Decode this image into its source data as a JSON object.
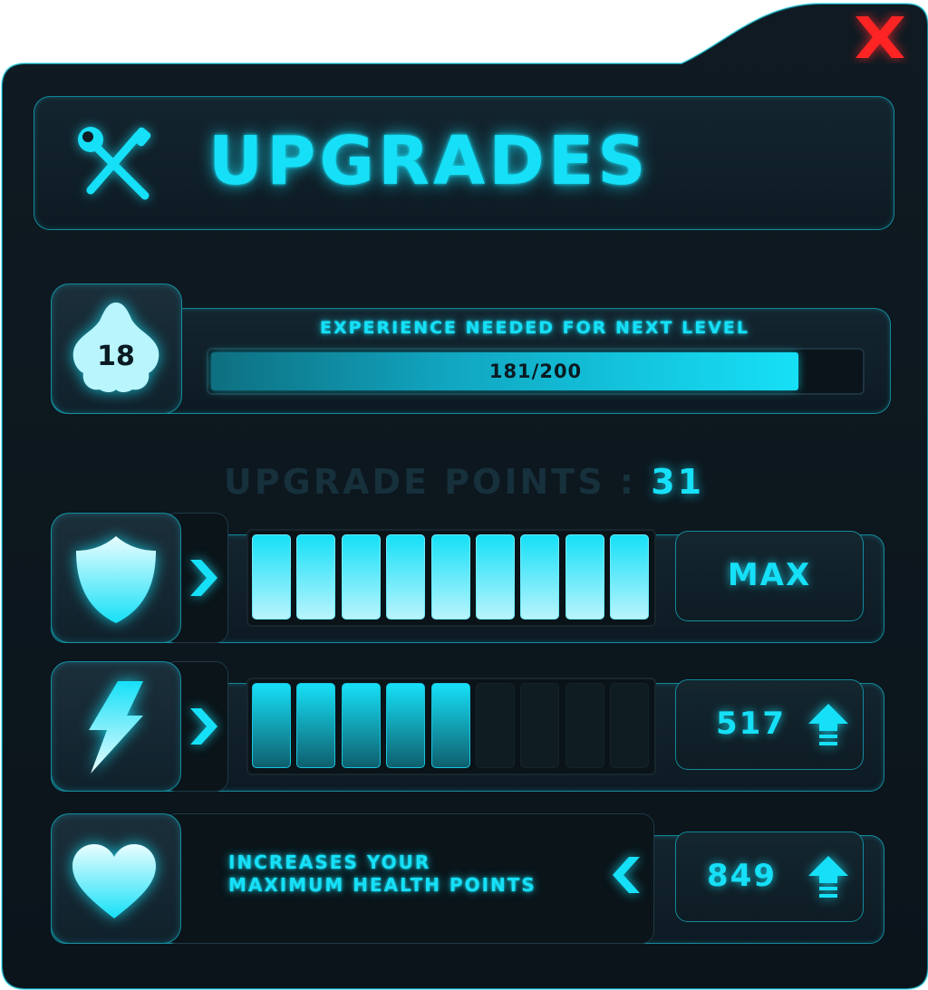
{
  "window": {
    "title": "UPGRADES",
    "close_icon": "close-x-icon",
    "accent": "#16e0f7",
    "close_color": "#ff2a2a"
  },
  "header": {
    "icon": "tools-wrench-screwdriver-icon"
  },
  "level": {
    "icon": "flame-badge-icon",
    "value": "18",
    "label": "EXPERIENCE NEEDED FOR NEXT LEVEL",
    "current": 181,
    "needed": 200,
    "text": "181/200"
  },
  "upgrade_points": {
    "label": "UPGRADE POINTS :",
    "value": "31"
  },
  "upgrades": [
    {
      "icon": "shield-icon",
      "arrow": "chevron-right-icon",
      "level": 9,
      "max": 9,
      "button_label": "MAX"
    },
    {
      "icon": "lightning-bolt-icon",
      "arrow": "chevron-right-icon",
      "level": 5,
      "max": 9,
      "button_label": "517",
      "button_icon": "upgrade-arrow-icon"
    },
    {
      "icon": "heart-icon",
      "arrow": "chevron-left-icon",
      "description_line1": "INCREASES YOUR",
      "description_line2": "MAXIMUM HEALTH POINTS",
      "button_label": "849",
      "button_icon": "upgrade-arrow-icon"
    }
  ]
}
